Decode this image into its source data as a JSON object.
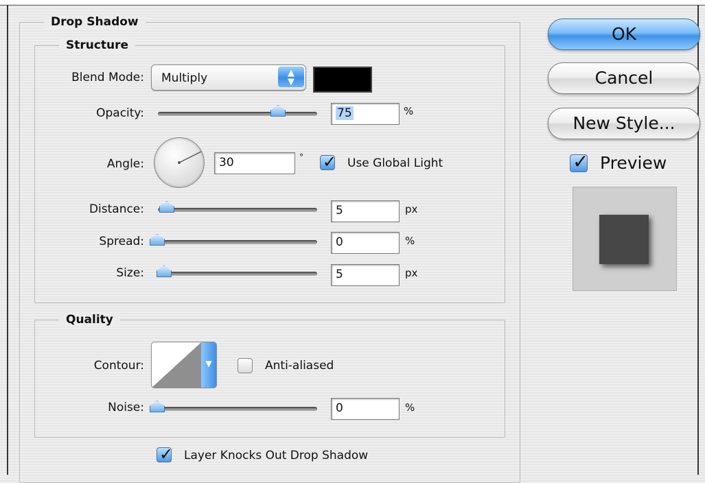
{
  "dialog": {
    "drop_shadow_legend": "Drop Shadow",
    "structure_legend": "Structure",
    "quality_legend": "Quality"
  },
  "structure": {
    "blend_mode_label": "Blend Mode:",
    "blend_mode_value": "Multiply",
    "shadow_color": "#000000",
    "opacity_label": "Opacity:",
    "opacity_value": "75",
    "opacity_unit": "%",
    "angle_label": "Angle:",
    "angle_value": "30",
    "angle_unit": "°",
    "use_global_light_label": "Use Global Light",
    "use_global_light_checked": true,
    "distance_label": "Distance:",
    "distance_value": "5",
    "distance_unit": "px",
    "spread_label": "Spread:",
    "spread_value": "0",
    "spread_unit": "%",
    "size_label": "Size:",
    "size_value": "5",
    "size_unit": "px"
  },
  "quality": {
    "contour_label": "Contour:",
    "anti_aliased_label": "Anti-aliased",
    "anti_aliased_checked": false,
    "noise_label": "Noise:",
    "noise_value": "0",
    "noise_unit": "%"
  },
  "footer": {
    "layer_knocks_out_label": "Layer Knocks Out Drop Shadow",
    "layer_knocks_out_checked": true
  },
  "buttons": {
    "ok": "OK",
    "cancel": "Cancel",
    "new_style": "New Style...",
    "preview_label": "Preview",
    "preview_checked": true
  },
  "icons": {
    "popup_arrows": "updown-arrows-icon",
    "checkmark": "checkmark-icon",
    "slider_thumb": "slider-thumb-icon",
    "dial": "angle-dial-icon"
  },
  "colors": {
    "accent_blue": "#3f94ea",
    "preview_square": "#474747",
    "preview_background": "#cfcfcf"
  }
}
